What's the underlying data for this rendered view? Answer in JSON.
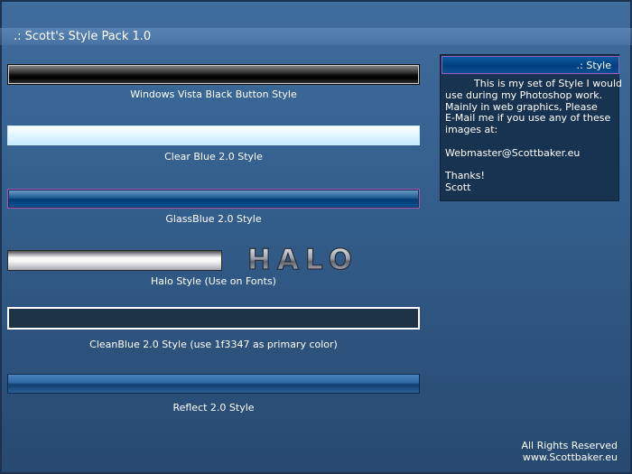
{
  "title": ".: Scott's Style Pack 1.0",
  "styles": [
    {
      "id": "vista",
      "caption": "Windows Vista Black Button Style"
    },
    {
      "id": "clearblue",
      "caption": "Clear Blue 2.0 Style"
    },
    {
      "id": "glassblue",
      "caption": "GlassBlue 2.0 Style"
    },
    {
      "id": "halo",
      "caption": "Halo Style (Use on Fonts)",
      "logo_text": "HALO"
    },
    {
      "id": "cleanblue",
      "caption": "CleanBlue 2.0 Style (use 1f3347 as primary color)"
    },
    {
      "id": "reflect",
      "caption": "Reflect 2.0 Style"
    }
  ],
  "side_panel": {
    "heading": ".: Style",
    "body_lines": [
      "This is my set of Style I would",
      "use during my Photoshop work.",
      "Mainly in web graphics, Please",
      "E-Mail me if you use any of these",
      "images at:",
      "",
      "Webmaster@Scottbaker.eu",
      "",
      "Thanks!",
      "Scott"
    ]
  },
  "footer": {
    "rights": "All Rights Reserved",
    "site": "www.Scottbaker.eu"
  },
  "colors": {
    "background": "#335d8b",
    "panel": "#18334f",
    "cleanblue_primary": "#1f3347",
    "accent_border": "#9b5cbf"
  }
}
